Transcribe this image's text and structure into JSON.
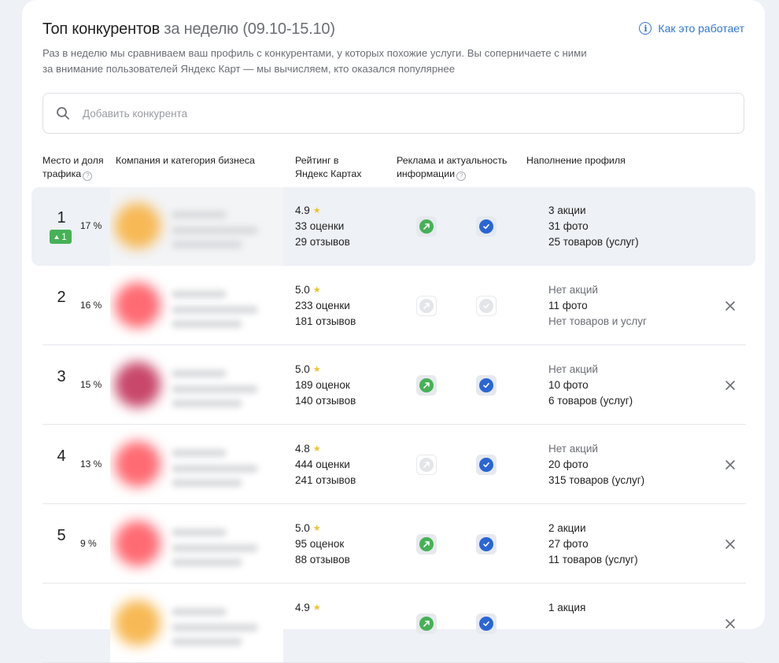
{
  "header": {
    "title_main": "Топ конкурентов",
    "title_suffix": " за неделю (09.10-15.10)",
    "how_link": "Как это работает",
    "description": "Раз в неделю мы сравниваем ваш профиль с конкурентами, у которых похожие услуги. Вы соперничаете с ними за внимание пользователей Яндекс Карт — мы вычисляем, кто оказался популярнее"
  },
  "search": {
    "placeholder": "Добавить конкурента"
  },
  "columns": {
    "place_share": "Место и доля трафика",
    "company": "Компания и категория бизнеса",
    "rating": "Рейтинг в Яндекс Картах",
    "ads": "Реклама и актуальность информации",
    "profile": "Наполнение профиля"
  },
  "rows": [
    {
      "rank": "1",
      "share": "17 %",
      "change": "1",
      "rating": "4.9",
      "ratings_count": "33 оценки",
      "reviews": "29 отзывов",
      "ad_active": true,
      "info_actual": true,
      "promos": "3 акции",
      "photos": "31 фото",
      "goods": "25 товаров (услуг)",
      "avatar_color": "#f7b955"
    },
    {
      "rank": "2",
      "share": "16 %",
      "change": "",
      "rating": "5.0",
      "ratings_count": "233 оценки",
      "reviews": "181 отзывов",
      "ad_active": false,
      "info_actual": false,
      "promos": "Нет акций",
      "photos": "11 фото",
      "goods": "Нет товаров и услуг",
      "avatar_color": "#ff6b73"
    },
    {
      "rank": "3",
      "share": "15 %",
      "change": "",
      "rating": "5.0",
      "ratings_count": "189 оценок",
      "reviews": "140 отзывов",
      "ad_active": true,
      "info_actual": true,
      "promos": "Нет акций",
      "photos": "10 фото",
      "goods": "6 товаров (услуг)",
      "avatar_color": "#c8476a"
    },
    {
      "rank": "4",
      "share": "13 %",
      "change": "",
      "rating": "4.8",
      "ratings_count": "444 оценки",
      "reviews": "241 отзывов",
      "ad_active": false,
      "info_actual": true,
      "promos": "Нет акций",
      "photos": "20 фото",
      "goods": "315 товаров (услуг)",
      "avatar_color": "#ff6b73"
    },
    {
      "rank": "5",
      "share": "9 %",
      "change": "",
      "rating": "5.0",
      "ratings_count": "95 оценок",
      "reviews": "88 отзывов",
      "ad_active": true,
      "info_actual": true,
      "promos": "2 акции",
      "photos": "27 фото",
      "goods": "11 товаров (услуг)",
      "avatar_color": "#ff6b73"
    },
    {
      "rank": "",
      "share": "",
      "change": "",
      "rating": "4.9",
      "ratings_count": "",
      "reviews": "",
      "ad_active": true,
      "info_actual": true,
      "promos": "1 акция",
      "photos": "",
      "goods": "",
      "avatar_color": "#f7b955"
    }
  ],
  "colors": {
    "accent": "#2f76d9",
    "positive": "#46b156",
    "check": "#2a66d4",
    "star": "#f2c12e"
  }
}
